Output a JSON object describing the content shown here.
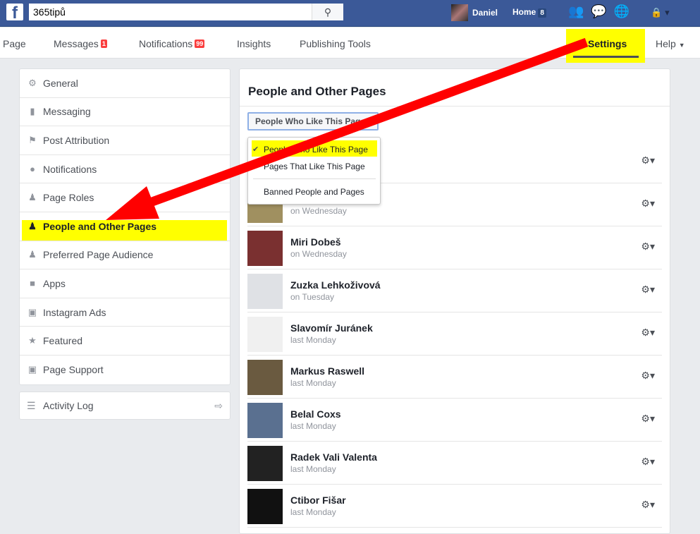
{
  "topbar": {
    "search_value": "365tipů",
    "user_name": "Daniel",
    "home_label": "Home",
    "home_count": "8"
  },
  "nav": {
    "items": [
      {
        "label": "Page"
      },
      {
        "label": "Messages",
        "badge": "1"
      },
      {
        "label": "Notifications",
        "badge": "99"
      },
      {
        "label": "Insights"
      },
      {
        "label": "Publishing Tools"
      }
    ],
    "settings": "Settings",
    "help": "Help"
  },
  "sidebar": {
    "items": [
      {
        "label": "General",
        "icon": "gear-icon"
      },
      {
        "label": "Messaging",
        "icon": "chat-icon"
      },
      {
        "label": "Post Attribution",
        "icon": "flag-icon"
      },
      {
        "label": "Notifications",
        "icon": "globe-icon"
      },
      {
        "label": "Page Roles",
        "icon": "person-icon"
      },
      {
        "label": "People and Other Pages",
        "icon": "person-add-icon",
        "active": true
      },
      {
        "label": "Preferred Page Audience",
        "icon": "person-add-icon"
      },
      {
        "label": "Apps",
        "icon": "cube-icon"
      },
      {
        "label": "Instagram Ads",
        "icon": "instagram-icon"
      },
      {
        "label": "Featured",
        "icon": "star-icon"
      },
      {
        "label": "Page Support",
        "icon": "facebook-icon"
      }
    ],
    "activity_log": "Activity Log"
  },
  "main": {
    "title": "People and Other Pages",
    "filter_selected": "People Who Like This Page",
    "filter_options": [
      "People Who Like This Page",
      "Pages That Like This Page",
      "Banned People and Pages"
    ],
    "people": [
      {
        "name": "",
        "time": ""
      },
      {
        "name": "",
        "time": "on Wednesday"
      },
      {
        "name": "Miri Dobeš",
        "time": "on Wednesday"
      },
      {
        "name": "Zuzka Lehkoživová",
        "time": "on Tuesday"
      },
      {
        "name": "Slavomír Juránek",
        "time": "last Monday"
      },
      {
        "name": "Markus Raswell",
        "time": "last Monday"
      },
      {
        "name": "Belal Coxs",
        "time": "last Monday"
      },
      {
        "name": "Radek Vali Valenta",
        "time": "last Monday"
      },
      {
        "name": "Ctibor Fišar",
        "time": "last Monday"
      }
    ]
  },
  "colors": {
    "brand": "#3b5998",
    "highlight": "#ffff00",
    "arrow": "#ff0000"
  }
}
